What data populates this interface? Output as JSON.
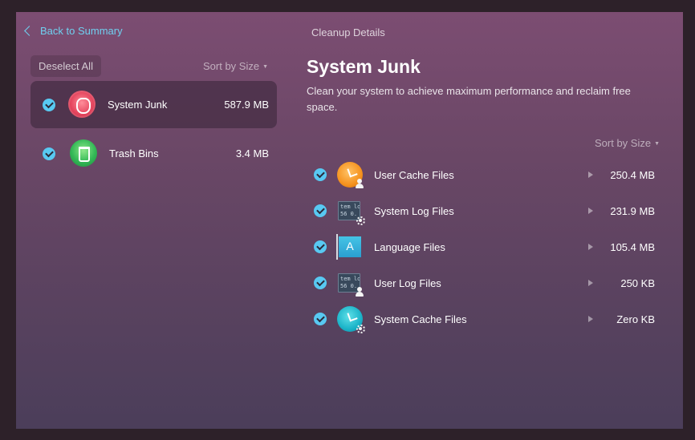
{
  "topbar": {
    "back_label": "Back to Summary",
    "title": "Cleanup Details"
  },
  "sidebar": {
    "deselect_label": "Deselect All",
    "sort_label": "Sort by Size",
    "items": [
      {
        "label": "System Junk",
        "size": "587.9 MB",
        "icon": "system-junk-icon",
        "selected": true
      },
      {
        "label": "Trash Bins",
        "size": "3.4 MB",
        "icon": "trash-bin-icon",
        "selected": false
      }
    ]
  },
  "detail": {
    "heading": "System Junk",
    "description": "Clean your system to achieve maximum performance and reclaim free space.",
    "sort_label": "Sort by Size",
    "log_sample": "tem lo\n56 0.",
    "lang_glyph": "A",
    "rows": [
      {
        "label": "User Cache Files",
        "size": "250.4 MB",
        "icon": "user-cache-icon"
      },
      {
        "label": "System Log Files",
        "size": "231.9 MB",
        "icon": "system-log-icon"
      },
      {
        "label": "Language Files",
        "size": "105.4 MB",
        "icon": "language-files-icon"
      },
      {
        "label": "User Log Files",
        "size": "250 KB",
        "icon": "user-log-icon"
      },
      {
        "label": "System Cache Files",
        "size": "Zero KB",
        "icon": "system-cache-icon"
      }
    ]
  },
  "colors": {
    "accent": "#58c9f2",
    "link": "#6fd0f0"
  }
}
